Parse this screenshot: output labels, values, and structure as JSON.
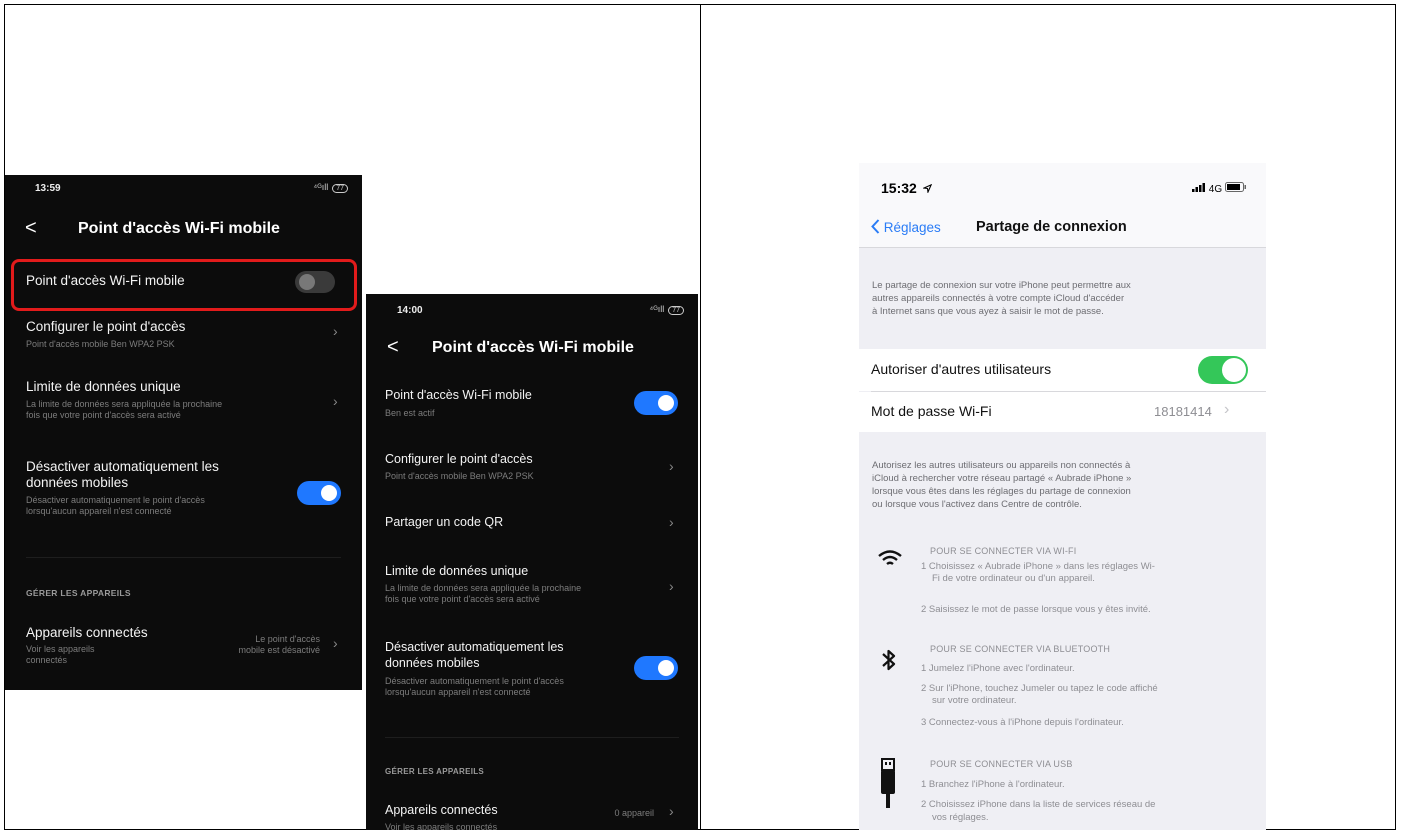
{
  "panel1": {
    "status_time": "13:59",
    "status_signal": "⁴ᴳıll",
    "status_battery": "77",
    "back": "<",
    "title": "Point d'accès Wi-Fi mobile",
    "hotspot_label": "Point d'accès Wi-Fi mobile",
    "configure_label": "Configurer le point d'accès",
    "configure_sub": "Point d'accès mobile Ben WPA2 PSK",
    "limit_label": "Limite de données unique",
    "limit_sub_1": "La limite de données sera appliquée la prochaine",
    "limit_sub_2": "fois que votre point d'accès sera activé",
    "auto_label_1": "Désactiver automatiquement les",
    "auto_label_2": "données mobiles",
    "auto_sub_1": "Désactiver automatiquement le point d'accès",
    "auto_sub_2": "lorsqu'aucun appareil n'est connecté",
    "section": "GÉRER LES APPAREILS",
    "devices_label": "Appareils connectés",
    "devices_sub_1": "Voir les appareils",
    "devices_sub_2": "connectés",
    "devices_value_1": "Le point d'accès",
    "devices_value_2": "mobile est désactivé",
    "chevron": "›",
    "hotspot_on": false,
    "auto_on": true,
    "highlight_color": "#e21b1b"
  },
  "panel2": {
    "status_time": "14:00",
    "status_signal": "⁴ᴳıll",
    "status_battery": "77",
    "back": "<",
    "title": "Point d'accès Wi-Fi mobile",
    "hotspot_label": "Point d'accès Wi-Fi mobile",
    "hotspot_sub": "Ben est actif",
    "configure_label": "Configurer le point d'accès",
    "configure_sub": "Point d'accès mobile Ben WPA2 PSK",
    "qr_label": "Partager un code QR",
    "limit_label": "Limite de données unique",
    "limit_sub_1": "La limite de données sera appliquée la prochaine",
    "limit_sub_2": "fois que votre point d'accès sera activé",
    "auto_label_1": "Désactiver automatiquement les",
    "auto_label_2": "données mobiles",
    "auto_sub_1": "Désactiver automatiquement le point d'accès",
    "auto_sub_2": "lorsqu'aucun appareil n'est connecté",
    "section": "GÉRER LES APPAREILS",
    "devices_label": "Appareils connectés",
    "devices_sub": "Voir les appareils connectés",
    "devices_value": "0 appareil",
    "chevron": "›",
    "hotspot_on": true,
    "auto_on": true,
    "accent_color": "#1f78ff"
  },
  "panel3": {
    "status_time": "15:32",
    "status_network": "4G",
    "back_label": "Réglages",
    "title": "Partage de connexion",
    "intro_1": "Le partage de connexion sur votre iPhone peut permettre aux",
    "intro_2": "autres appareils connectés à votre compte iCloud d'accéder",
    "intro_3": "à Internet sans que vous ayez à saisir le mot de passe.",
    "allow_label": "Autoriser d'autres utilisateurs",
    "allow_on": true,
    "password_label": "Mot de passe Wi-Fi",
    "password_value": "18181414",
    "chevron": "›",
    "note_1": "Autorisez les autres utilisateurs ou appareils non connectés à",
    "note_2": "iCloud à rechercher votre réseau partagé « Aubrade iPhone »",
    "note_3": "lorsque vous êtes dans les réglages du partage de connexion",
    "note_4": "ou lorsque vous l'activez dans Centre de contrôle.",
    "wifi_title": "POUR SE CONNECTER VIA WI-FI",
    "wifi_step_1a": "1 Choisissez « Aubrade iPhone » dans les réglages Wi-",
    "wifi_step_1b": "Fi de votre ordinateur ou d'un appareil.",
    "wifi_step_2": "2 Saisissez le mot de passe lorsque vous y êtes invité.",
    "bt_title": "POUR SE CONNECTER VIA BLUETOOTH",
    "bt_step_1": "1 Jumelez l'iPhone avec l'ordinateur.",
    "bt_step_2a": "2 Sur l'iPhone, touchez Jumeler ou tapez le code affiché",
    "bt_step_2b": "sur votre ordinateur.",
    "bt_step_3": "3 Connectez-vous à l'iPhone depuis l'ordinateur.",
    "usb_title": "POUR SE CONNECTER VIA USB",
    "usb_step_1": "1 Branchez l'iPhone à l'ordinateur.",
    "usb_step_2a": "2 Choisissez iPhone dans la liste de services réseau de",
    "usb_step_2b": "vos réglages.",
    "toggle_color": "#34c759",
    "link_color": "#2a7cf6"
  }
}
